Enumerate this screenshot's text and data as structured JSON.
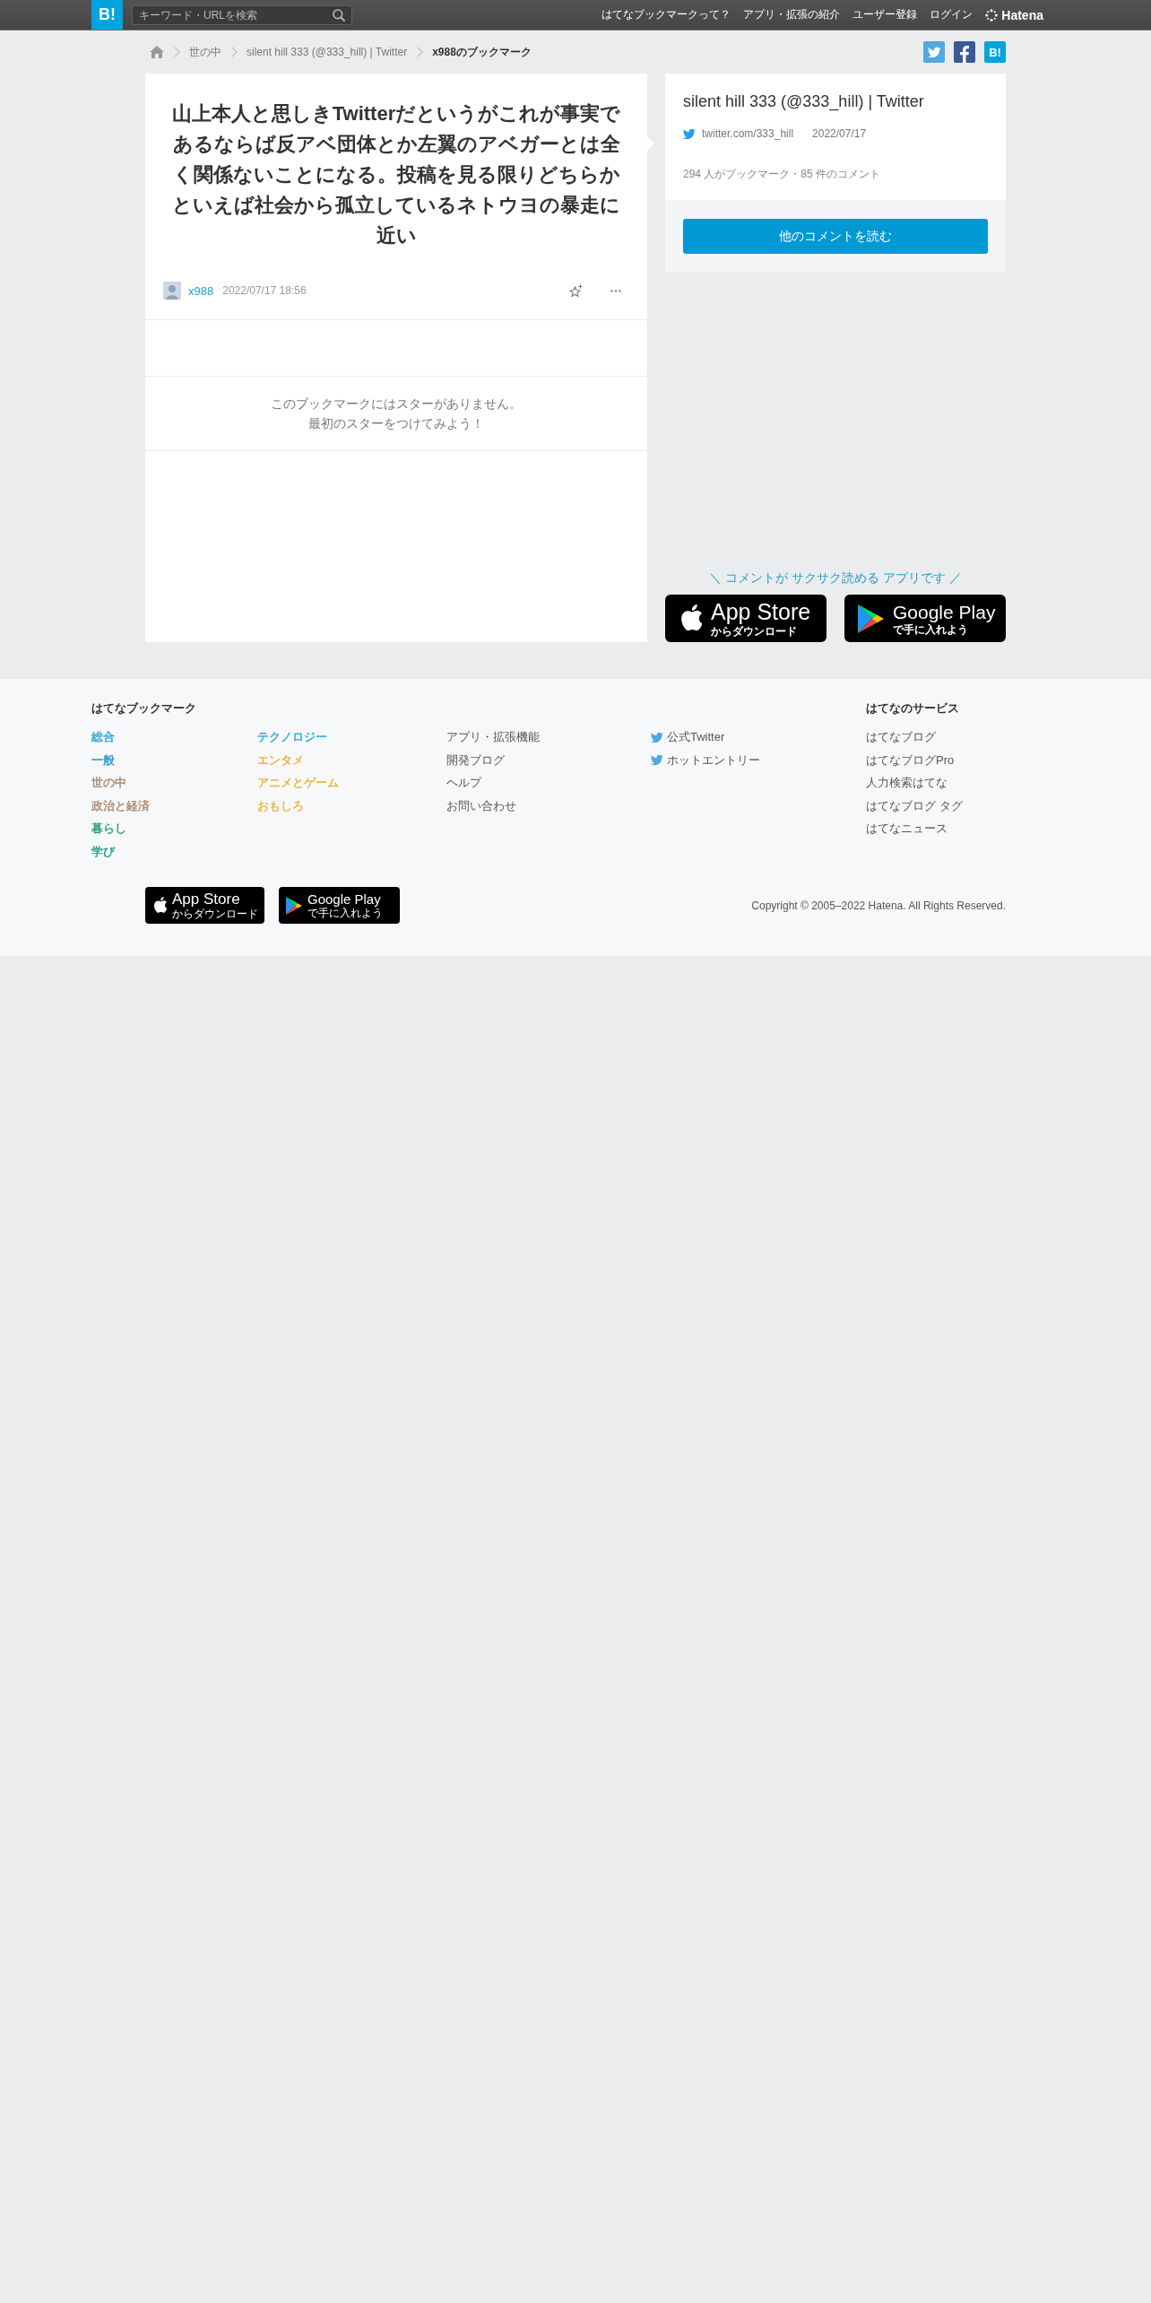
{
  "header": {
    "logo": "B!",
    "search": {
      "placeholder": "キーワード・URLを検索"
    },
    "nav": [
      "はてなブックマークって？",
      "アプリ・拡張の紹介",
      "ユーザー登録",
      "ログイン"
    ],
    "brand": "Hatena"
  },
  "breadcrumb": {
    "links": [
      "世の中",
      "silent hill 333 (@333_hill) | Twitter"
    ],
    "current": "x988のブックマーク"
  },
  "share_buttons": [
    {
      "kind": "twitter"
    },
    {
      "kind": "facebook"
    },
    {
      "kind": "hatena",
      "label": "B!"
    }
  ],
  "bookmark": {
    "comment": "山上本人と思しきTwitterだというがこれが事実であるならば反アベ団体とか左翼のアベガーとは全く関係ないことになる。投稿を見る限りどちらかといえば社会から孤立しているネトウヨの暴走に近い",
    "user": "x988",
    "timestamp": "2022/07/17 18:56",
    "no_stars_message": [
      "このブックマークにはスターがありません。",
      "最初のスターをつけてみよう！"
    ]
  },
  "entry": {
    "title": "silent hill 333 (@333_hill) | Twitter",
    "domain": "twitter.com/333_hill",
    "date": "2022/07/17",
    "counts": "294 人がブックマーク・85 件のコメント",
    "button": "他のコメントを読む"
  },
  "app_promo": {
    "tagline": "＼ コメントが サクサク読める アプリです ／",
    "badges": [
      {
        "kind": "apple",
        "title": "App Store",
        "subtitle": "からダウンロード"
      },
      {
        "kind": "google",
        "title": "Google Play",
        "subtitle": "で手に入れよう"
      }
    ]
  },
  "footer": {
    "heading": "はてなブックマーク",
    "category_columns": [
      [
        {
          "label": "総合",
          "color": "#2a9fd8"
        },
        {
          "label": "一般",
          "color": "#2892d0"
        },
        {
          "label": "世の中",
          "color": "#a5886b"
        },
        {
          "label": "政治と経済",
          "color": "#a5886b"
        },
        {
          "label": "暮らし",
          "color": "#2a9e6f"
        },
        {
          "label": "学び",
          "color": "#1e9b84"
        }
      ],
      [
        {
          "label": "テクノロジー",
          "color": "#29abd6"
        },
        {
          "label": "エンタメ",
          "color": "#eeaf33"
        },
        {
          "label": "アニメとゲーム",
          "color": "#eeaf33"
        },
        {
          "label": "おもしろ",
          "color": "#e9b43c"
        }
      ]
    ],
    "links": [
      "アプリ・拡張機能",
      "開発ブログ",
      "ヘルプ",
      "お問い合わせ"
    ],
    "social": [
      {
        "kind": "twitter",
        "label": "公式Twitter"
      },
      {
        "kind": "twitter",
        "label": "ホットエントリー"
      }
    ],
    "services_heading": "はてなのサービス",
    "services": [
      "はてなブログ",
      "はてなブログPro",
      "人力検索はてな",
      "はてなブログ タグ",
      "はてなニュース"
    ],
    "badges": [
      {
        "kind": "apple",
        "title": "App Store",
        "subtitle": "からダウンロード"
      },
      {
        "kind": "google",
        "title": "Google Play",
        "subtitle": "で手に入れよう"
      }
    ],
    "copyright": "Copyright © 2005–2022 Hatena. All Rights Reserved."
  }
}
